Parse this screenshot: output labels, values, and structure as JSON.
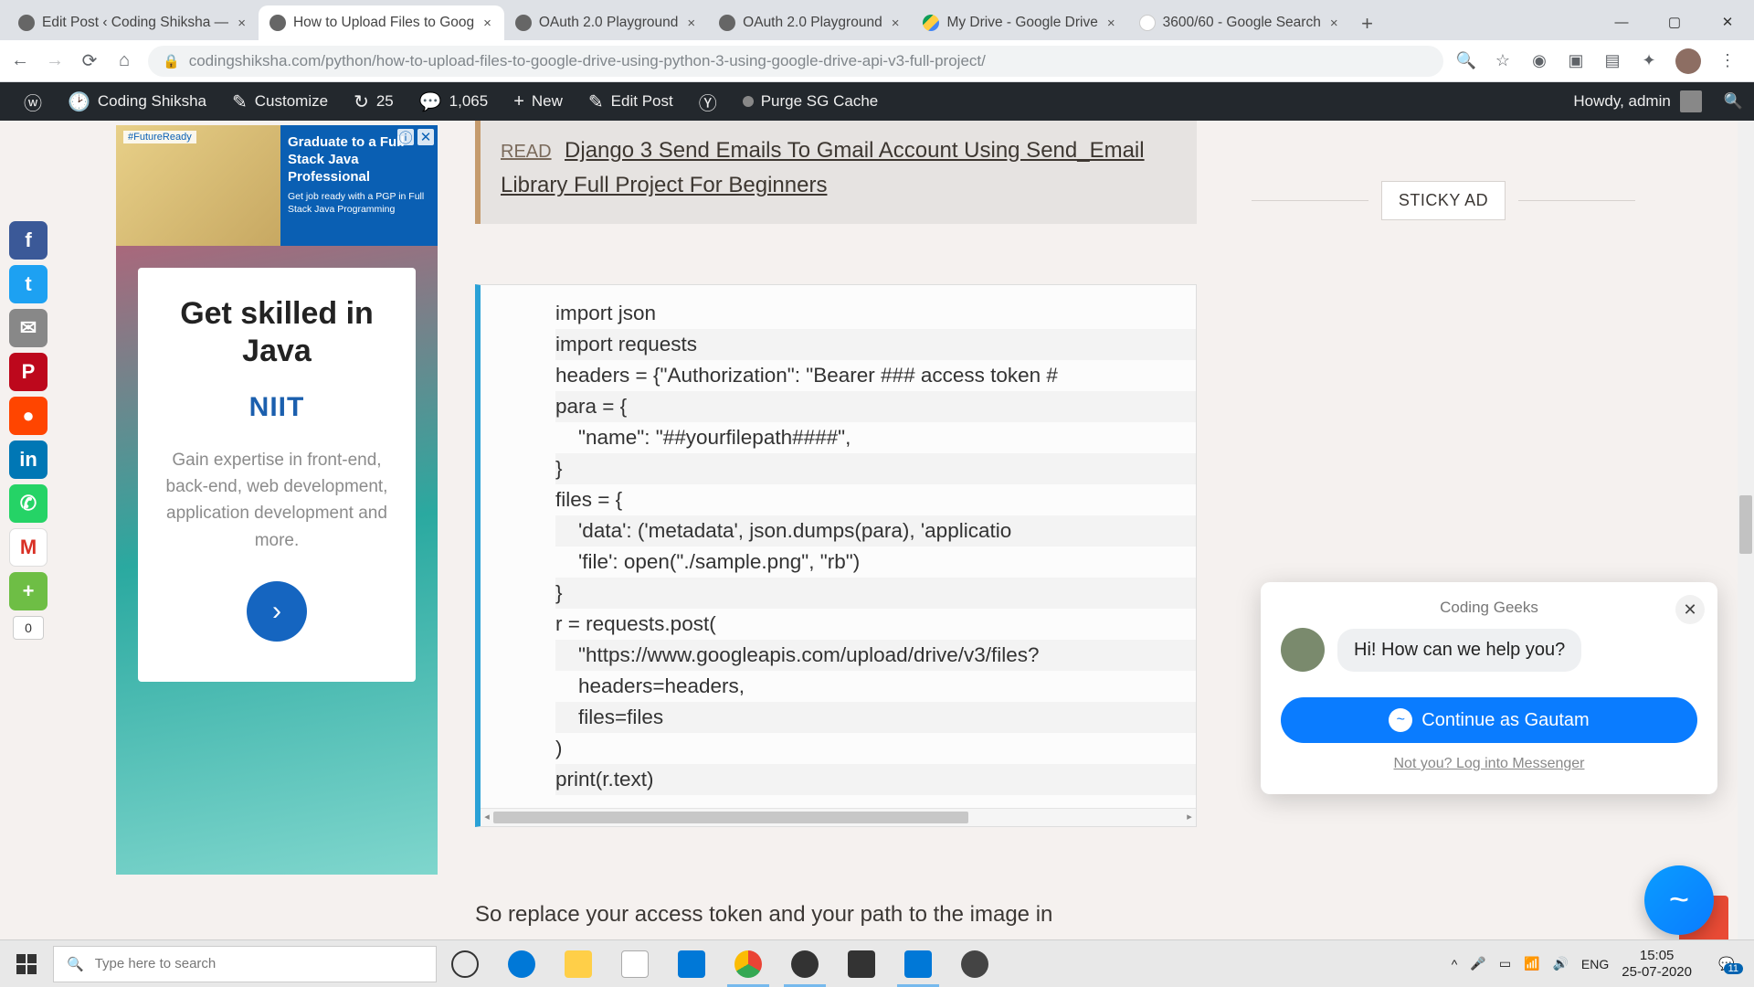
{
  "tabs": [
    {
      "label": "Edit Post ‹ Coding Shiksha —"
    },
    {
      "label": "How to Upload Files to Goog"
    },
    {
      "label": "OAuth 2.0 Playground"
    },
    {
      "label": "OAuth 2.0 Playground"
    },
    {
      "label": "My Drive - Google Drive"
    },
    {
      "label": "3600/60 - Google Search"
    }
  ],
  "url": {
    "host": "codingshiksha.com",
    "path": "/python/how-to-upload-files-to-google-drive-using-python-3-using-google-drive-api-v3-full-project/"
  },
  "wp": {
    "site": "Coding Shiksha",
    "customize": "Customize",
    "rev": "25",
    "comments": "1,065",
    "new": "New",
    "edit": "Edit Post",
    "purge": "Purge SG Cache",
    "howdy": "Howdy, admin"
  },
  "share": {
    "count": "0"
  },
  "ad": {
    "tag": "#FutureReady",
    "banner_title": "Graduate to a Full Stack Java Professional",
    "banner_sub": "Get job ready with a PGP in Full Stack Java Programming",
    "card_title": "Get skilled in Java",
    "logo": "NIIT",
    "card_body": "Gain expertise in front-end, back-end, web development, application development and more."
  },
  "read": {
    "label": "READ",
    "link": "Django 3 Send Emails To Gmail Account Using Send_Email Library Full Project For Beginners"
  },
  "code": [
    "import json",
    "import requests",
    "headers = {\"Authorization\": \"Bearer ### access token #",
    "para = {",
    "    \"name\": \"##yourfilepath####\",",
    "}",
    "files = {",
    "    'data': ('metadata', json.dumps(para), 'applicatio",
    "    'file': open(\"./sample.png\", \"rb\")",
    "}",
    "r = requests.post(",
    "    \"https://www.googleapis.com/upload/drive/v3/files?",
    "    headers=headers,",
    "    files=files",
    ")",
    "print(r.text)"
  ],
  "bodytext": "So replace your access token and your path to the image in",
  "sticky": "STICKY AD",
  "msgr": {
    "title": "Coding Geeks",
    "greet": "Hi! How can we help you?",
    "btn": "Continue as Gautam",
    "alt": "Not you? Log into Messenger"
  },
  "taskbar": {
    "search_ph": "Type here to search",
    "lang": "ENG",
    "time": "15:05",
    "date": "25-07-2020",
    "notif": "11"
  }
}
